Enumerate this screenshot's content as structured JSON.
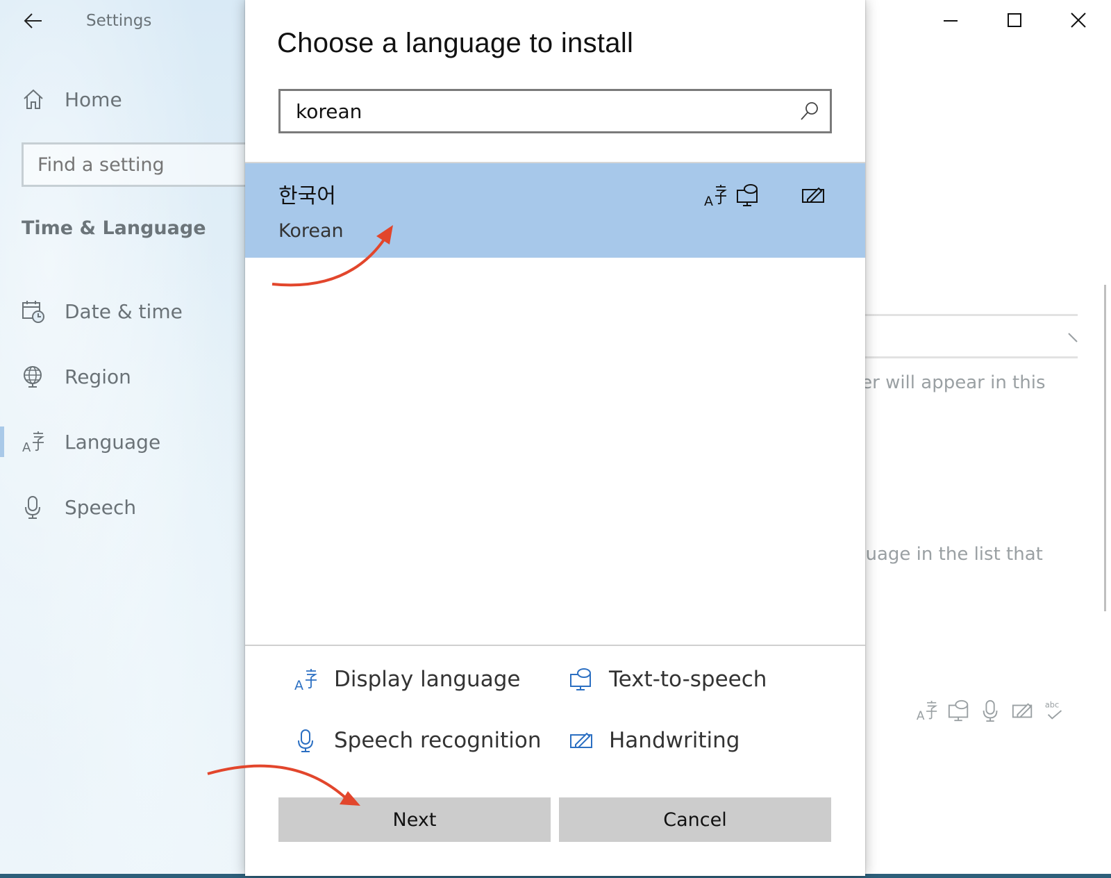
{
  "window": {
    "title": "Settings",
    "controls": {
      "minimize_icon": "minimize-icon",
      "maximize_icon": "maximize-icon",
      "close_icon": "close-icon"
    }
  },
  "sidebar": {
    "home_label": "Home",
    "search_placeholder": "Find a setting",
    "section_title": "Time & Language",
    "items": [
      {
        "label": "Date & time",
        "icon": "calendar-clock-icon",
        "selected": false
      },
      {
        "label": "Region",
        "icon": "globe-icon",
        "selected": false
      },
      {
        "label": "Language",
        "icon": "language-icon",
        "selected": true
      },
      {
        "label": "Speech",
        "icon": "microphone-icon",
        "selected": false
      }
    ]
  },
  "background_content": {
    "text_1": "rer will appear in this",
    "text_2": "guage in the list that"
  },
  "dialog": {
    "title": "Choose a language to install",
    "search": {
      "value": "korean",
      "placeholder": ""
    },
    "results": [
      {
        "native_name": "한국어",
        "english_name": "Korean",
        "selected": true,
        "features": [
          "display-language-icon",
          "text-to-speech-icon",
          "handwriting-icon"
        ]
      }
    ],
    "legend": [
      {
        "label": "Display language",
        "icon": "display-language-icon"
      },
      {
        "label": "Text-to-speech",
        "icon": "text-to-speech-icon"
      },
      {
        "label": "Speech recognition",
        "icon": "speech-recognition-icon"
      },
      {
        "label": "Handwriting",
        "icon": "handwriting-icon"
      }
    ],
    "buttons": {
      "next": "Next",
      "cancel": "Cancel"
    }
  },
  "colors": {
    "selection": "#a7c8ea",
    "accent_icon": "#2b6fc2",
    "annotation_arrow": "#e2462c",
    "button_bg": "#cccccc"
  }
}
